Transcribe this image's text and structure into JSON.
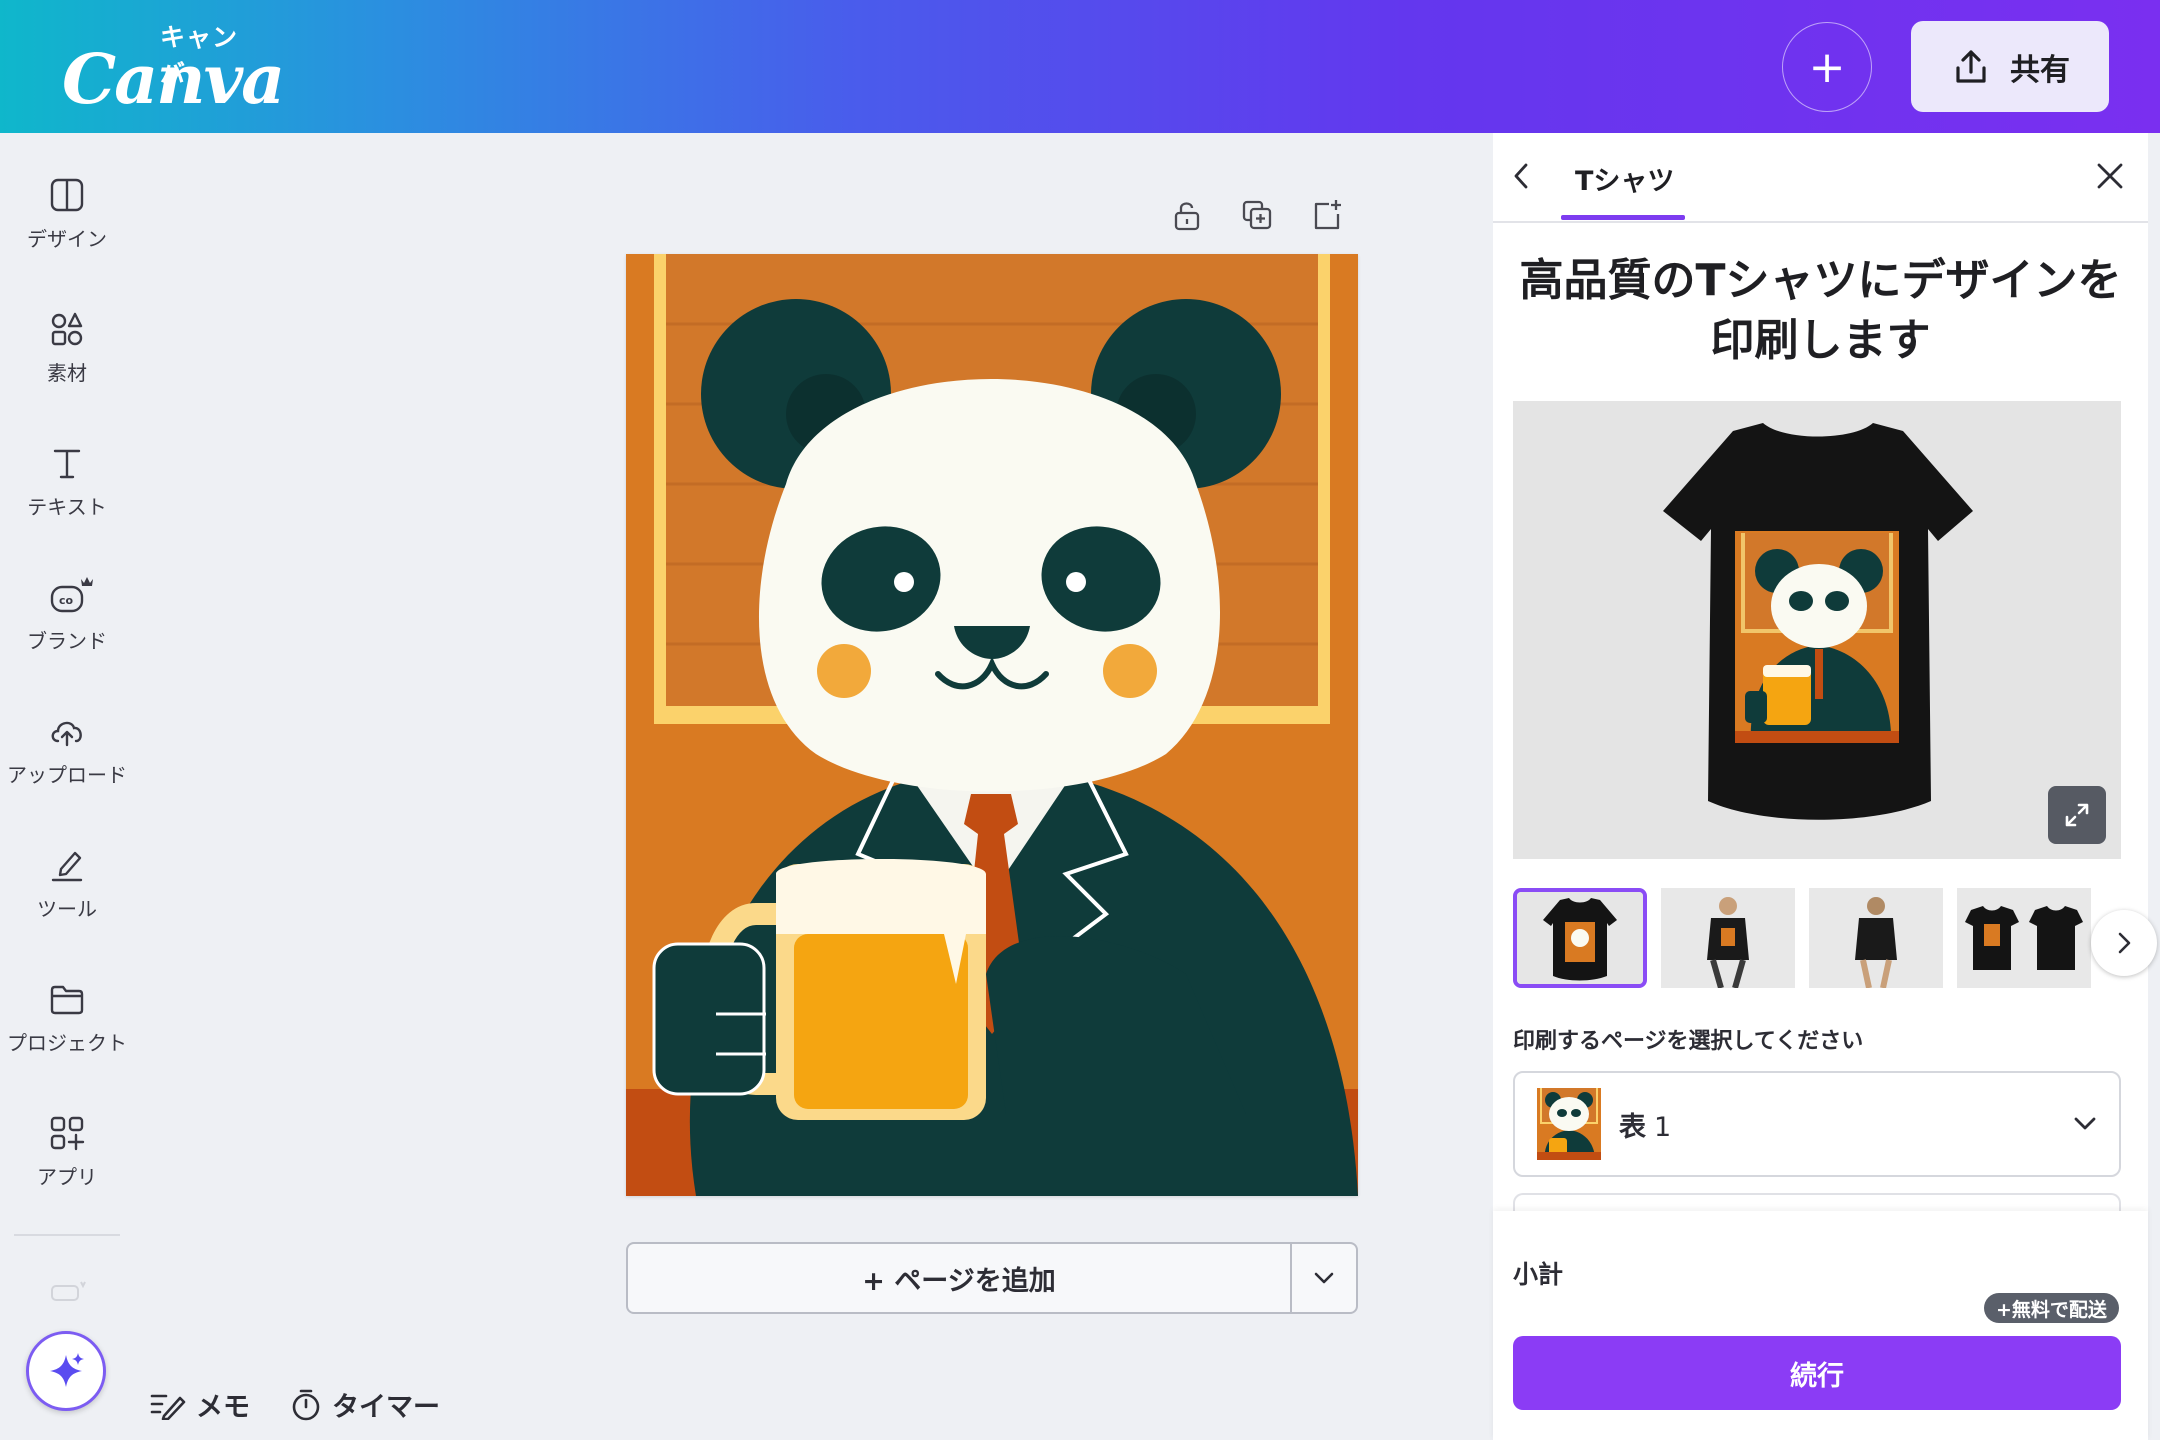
{
  "app": {
    "logo_sub": "キャンバ",
    "logo_main": "Canva",
    "share_label": "共有"
  },
  "sidebar": {
    "items": [
      {
        "label": "デザイン",
        "icon": "layout-icon"
      },
      {
        "label": "素材",
        "icon": "elements-icon"
      },
      {
        "label": "テキスト",
        "icon": "text-icon"
      },
      {
        "label": "ブランド",
        "icon": "brand-icon"
      },
      {
        "label": "アップロード",
        "icon": "upload-cloud-icon"
      },
      {
        "label": "ツール",
        "icon": "draw-tool-icon"
      },
      {
        "label": "プロジェクト",
        "icon": "folder-icon"
      },
      {
        "label": "アプリ",
        "icon": "apps-icon"
      }
    ]
  },
  "bottom_bar": {
    "memo_label": "メモ",
    "timer_label": "タイマー"
  },
  "canvas": {
    "add_page_label": "+ ページを追加"
  },
  "panel": {
    "title": "Tシャツ",
    "heading_line1": "高品質のTシャツにデザインを",
    "heading_line2": "印刷します",
    "select_label": "印刷するページを選択してください",
    "selected_page": "表",
    "selected_page_num": "1",
    "subtotal_label": "小計",
    "free_shipping": "+無料で配送",
    "continue_label": "続行"
  },
  "colors": {
    "accent": "#8b3cf5",
    "panda_dark": "#0f3b3a",
    "background_orange": "#d97a22"
  }
}
